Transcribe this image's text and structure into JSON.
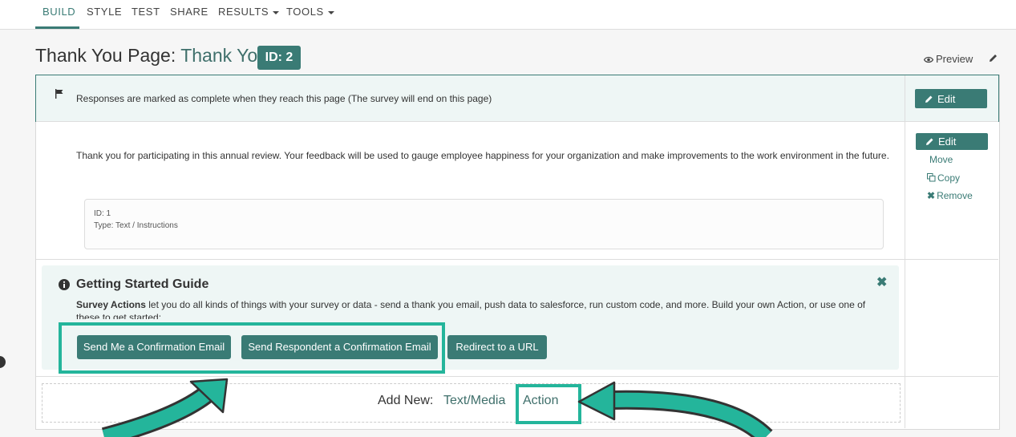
{
  "nav": {
    "tabs": [
      "BUILD",
      "STYLE",
      "TEST",
      "SHARE",
      "RESULTS",
      "TOOLS"
    ]
  },
  "header": {
    "title_prefix": "Thank You Page:",
    "title_name": "Thank You!",
    "id_badge": "ID: 2",
    "preview_label": "Preview"
  },
  "complete_row": {
    "text": "Responses are marked as complete when they reach this page (The survey will end on this page)",
    "edit_label": "Edit"
  },
  "question": {
    "text": "Thank you for participating in this annual review. Your feedback will be used to gauge employee happiness for your organization and make improvements to the work environment in the future.",
    "id_line": "ID: 1",
    "type_line": "Type: Text / Instructions",
    "edit_label": "Edit",
    "move_label": "Move",
    "copy_label": "Copy",
    "remove_label": "Remove"
  },
  "guide": {
    "title": "Getting Started Guide",
    "bold": "Survey Actions",
    "text": " let you do all kinds of things with your survey or data - send a thank you email, push data to salesforce, run custom code, and more. Build your own Action, or use one of these to get started:",
    "buttons": [
      "Send Me a Confirmation Email",
      "Send Respondent a Confirmation Email",
      "Redirect to a URL"
    ],
    "close": "✖"
  },
  "add_new": {
    "label": "Add New:",
    "links": [
      "Text/Media",
      "Action"
    ]
  },
  "colors": {
    "accent": "#3a7b75",
    "highlight": "#24b59b"
  }
}
